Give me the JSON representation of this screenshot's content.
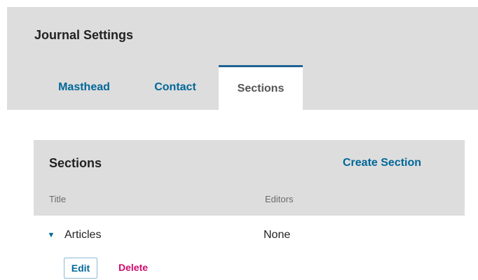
{
  "header": {
    "title": "Journal Settings",
    "tabs": [
      {
        "label": "Masthead"
      },
      {
        "label": "Contact"
      },
      {
        "label": "Sections"
      }
    ],
    "active_tab": "Sections"
  },
  "sections_panel": {
    "title": "Sections",
    "create_label": "Create Section",
    "columns": {
      "title": "Title",
      "editors": "Editors"
    },
    "rows": [
      {
        "title": "Articles",
        "editors": "None",
        "toggle_icon": "triangle-down-icon",
        "actions": {
          "edit_label": "Edit",
          "delete_label": "Delete"
        }
      }
    ]
  },
  "colors": {
    "link": "#006798",
    "delete": "#d00a6c",
    "header_bg": "#dddddd",
    "active_tab_border": "#1e6292"
  }
}
